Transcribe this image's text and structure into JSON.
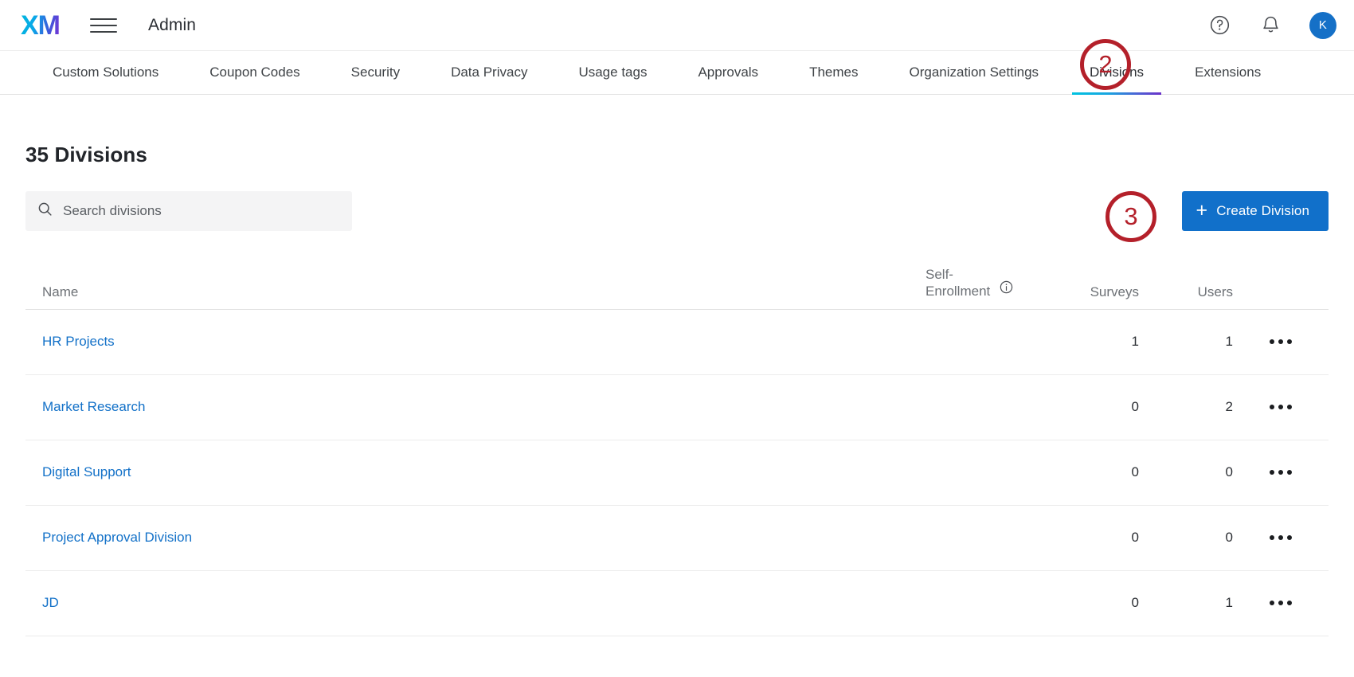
{
  "topbar": {
    "logo_text": "XM",
    "menu_icon": "hamburger-icon",
    "title": "Admin",
    "help_icon": "help-circle-icon",
    "notifications_icon": "bell-icon",
    "avatar_initial": "K"
  },
  "nav": {
    "tabs": [
      {
        "label": "Custom Solutions",
        "active": false
      },
      {
        "label": "Coupon Codes",
        "active": false
      },
      {
        "label": "Security",
        "active": false
      },
      {
        "label": "Data Privacy",
        "active": false
      },
      {
        "label": "Usage tags",
        "active": false
      },
      {
        "label": "Approvals",
        "active": false
      },
      {
        "label": "Themes",
        "active": false
      },
      {
        "label": "Organization Settings",
        "active": false
      },
      {
        "label": "Divisions",
        "active": true
      },
      {
        "label": "Extensions",
        "active": false
      }
    ]
  },
  "page": {
    "title": "35 Divisions"
  },
  "search": {
    "placeholder": "Search divisions",
    "value": "",
    "icon": "search-icon"
  },
  "create_button": {
    "label": "Create Division",
    "icon": "plus-icon",
    "color": "#1170ca"
  },
  "table": {
    "headers": {
      "name": "Name",
      "self_enrollment": "Self-Enrollment",
      "self_enrollment_info_icon": "info-circle-icon",
      "surveys": "Surveys",
      "users": "Users"
    },
    "rows": [
      {
        "name": "HR Projects",
        "self_enrollment": "",
        "surveys": "1",
        "users": "1",
        "menu_icon": "ellipsis-icon"
      },
      {
        "name": "Market Research",
        "self_enrollment": "",
        "surveys": "0",
        "users": "2",
        "menu_icon": "ellipsis-icon"
      },
      {
        "name": "Digital Support",
        "self_enrollment": "",
        "surveys": "0",
        "users": "0",
        "menu_icon": "ellipsis-icon"
      },
      {
        "name": "Project Approval Division",
        "self_enrollment": "",
        "surveys": "0",
        "users": "0",
        "menu_icon": "ellipsis-icon"
      },
      {
        "name": "JD",
        "self_enrollment": "",
        "surveys": "0",
        "users": "1",
        "menu_icon": "ellipsis-icon"
      }
    ]
  },
  "annotations": [
    {
      "label": "2",
      "color": "#b4202a"
    },
    {
      "label": "3",
      "color": "#b4202a"
    }
  ]
}
